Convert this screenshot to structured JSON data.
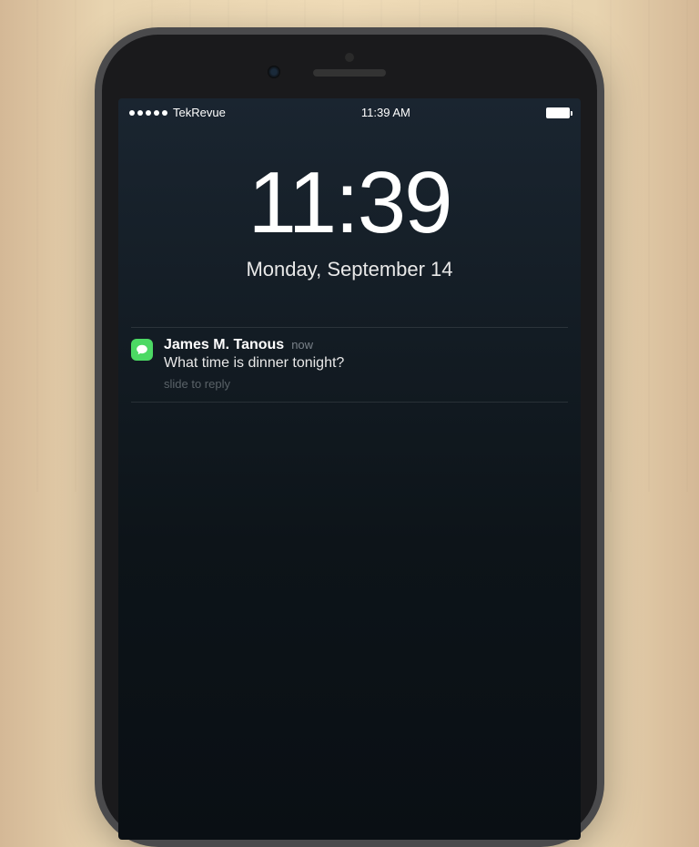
{
  "status_bar": {
    "carrier": "TekRevue",
    "time": "11:39 AM"
  },
  "lock_screen": {
    "time": "11:39",
    "date": "Monday, September 14"
  },
  "notification": {
    "app_icon": "messages-icon",
    "sender": "James M. Tanous",
    "timestamp": "now",
    "message": "What time is dinner tonight?",
    "hint": "slide to reply"
  }
}
